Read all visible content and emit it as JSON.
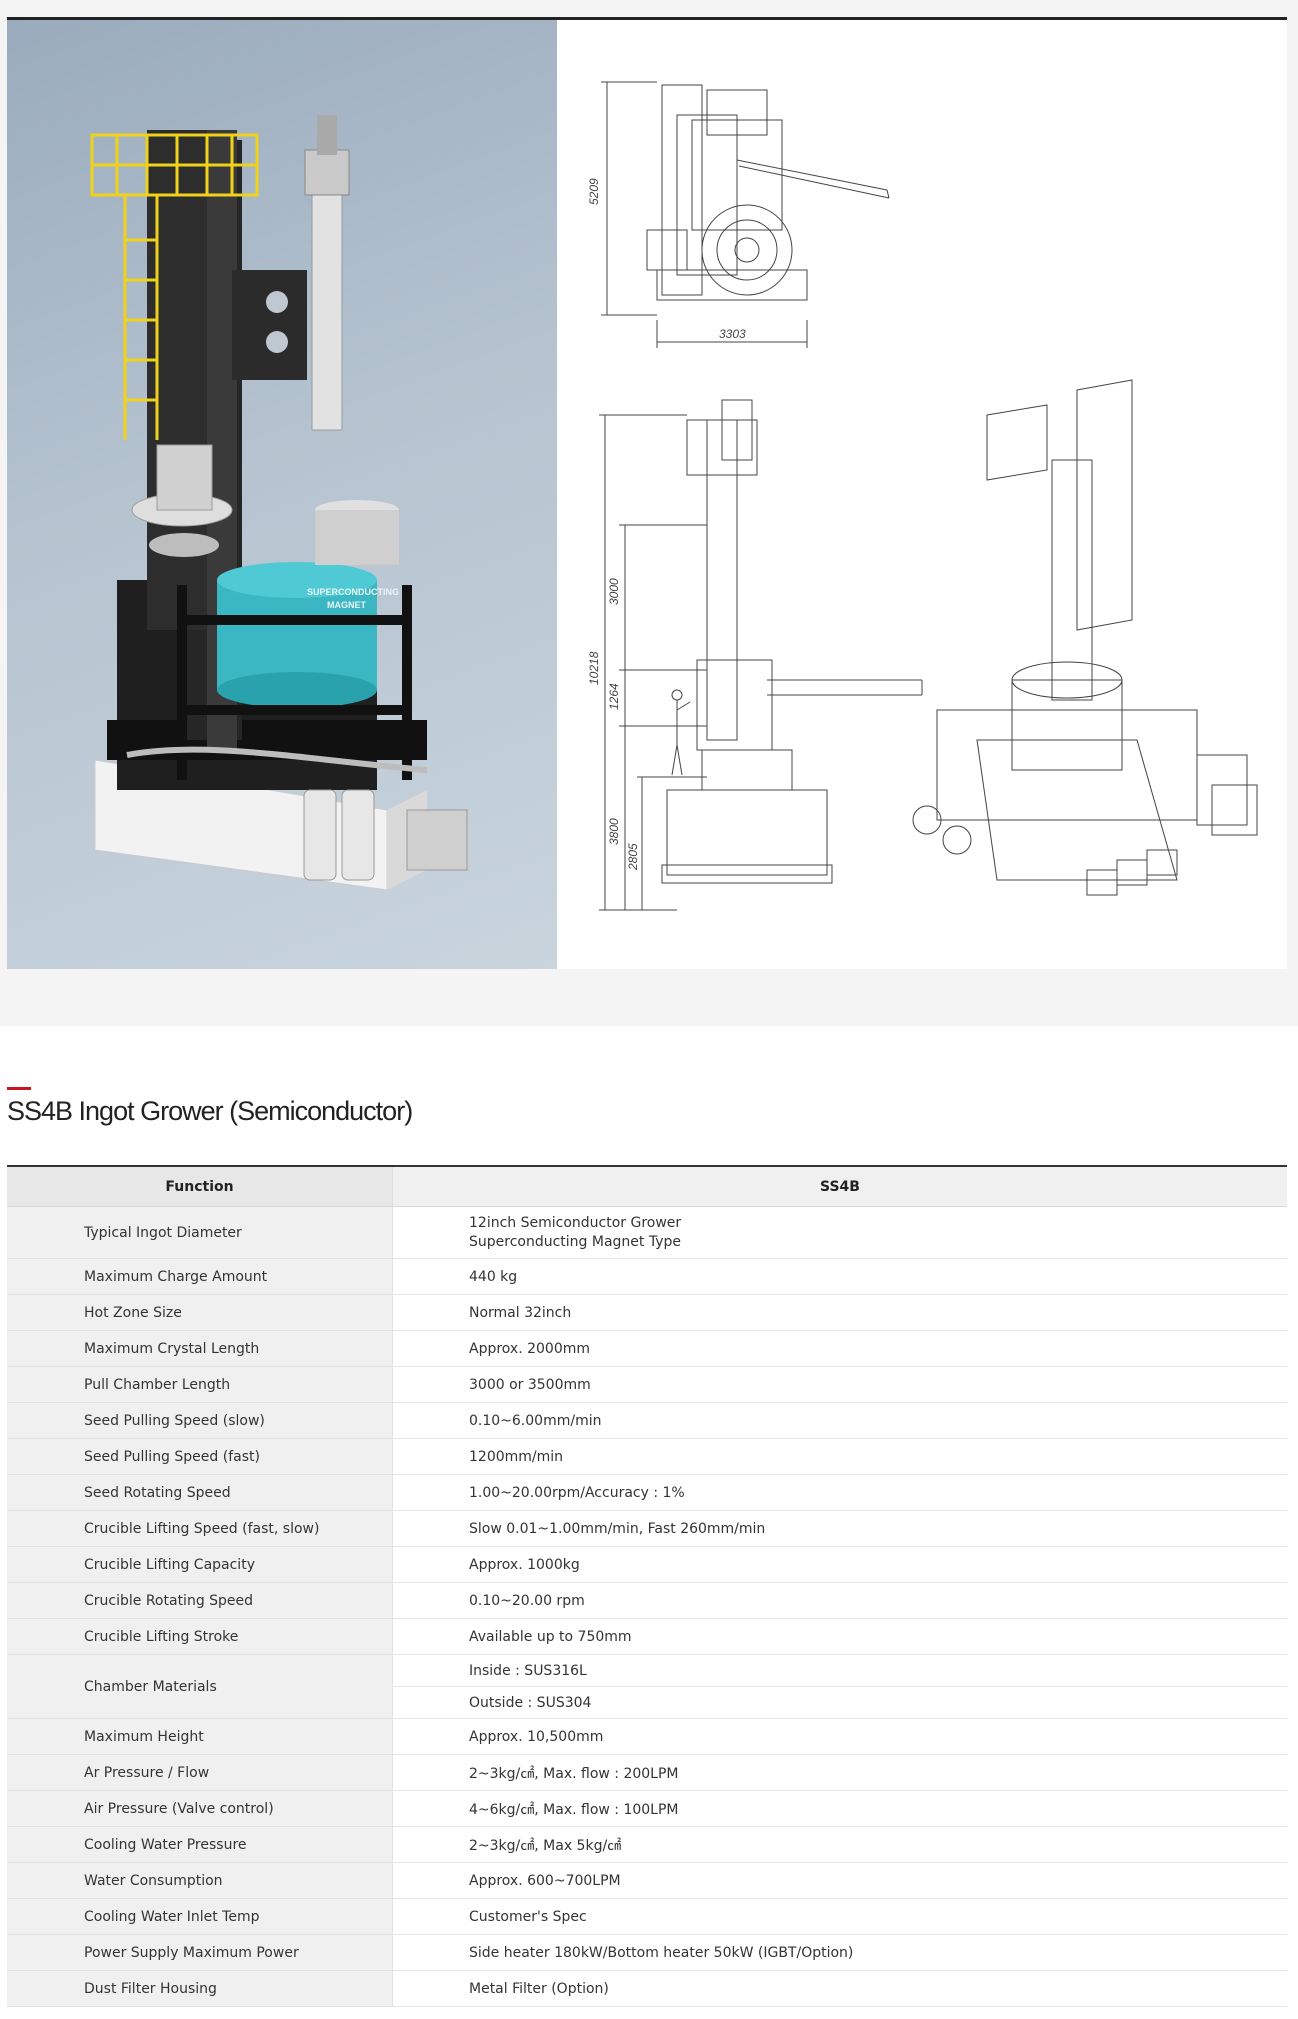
{
  "render": {
    "magnet_label_line1": "SUPERCONDUCTING",
    "magnet_label_line2": "MAGNET"
  },
  "drawing": {
    "top_view_dim_height": "5209",
    "top_view_dim_width": "3303",
    "side_view_dims": [
      "10218",
      "3000",
      "1264",
      "3800",
      "2805"
    ]
  },
  "section": {
    "title": "SS4B Ingot Grower (Semiconductor)"
  },
  "table": {
    "headers": [
      "Function",
      "SS4B"
    ],
    "rows": [
      {
        "label": "Typical Ingot Diameter",
        "values": [
          "12inch Semiconductor Grower",
          "Superconducting Magnet Type"
        ]
      },
      {
        "label": "Maximum Charge Amount",
        "values": [
          "440 kg"
        ]
      },
      {
        "label": "Hot Zone Size",
        "values": [
          "Normal 32inch"
        ]
      },
      {
        "label": "Maximum Crystal Length",
        "values": [
          "Approx. 2000mm"
        ]
      },
      {
        "label": "Pull Chamber Length",
        "values": [
          "3000 or 3500mm"
        ]
      },
      {
        "label": "Seed Pulling Speed (slow)",
        "values": [
          "0.10~6.00mm/min"
        ]
      },
      {
        "label": "Seed Pulling Speed (fast)",
        "values": [
          "1200mm/min"
        ]
      },
      {
        "label": "Seed Rotating Speed",
        "values": [
          "1.00~20.00rpm/Accuracy : 1%"
        ]
      },
      {
        "label": "Crucible Lifting Speed (fast, slow)",
        "values": [
          "Slow 0.01~1.00mm/min, Fast 260mm/min"
        ]
      },
      {
        "label": "Crucible Lifting Capacity",
        "values": [
          "Approx. 1000kg"
        ]
      },
      {
        "label": "Crucible Rotating Speed",
        "values": [
          "0.10~20.00 rpm"
        ]
      },
      {
        "label": "Crucible Lifting Stroke",
        "values": [
          "Available up to 750mm"
        ]
      },
      {
        "label": "Chamber Materials",
        "values": [
          "Inside : SUS316L",
          "Outside : SUS304"
        ]
      },
      {
        "label": "Maximum Height",
        "values": [
          "Approx. 10,500mm"
        ]
      },
      {
        "label": "Ar Pressure / Flow",
        "values": [
          "2~3kg/㎠, Max. flow : 200LPM"
        ]
      },
      {
        "label": "Air Pressure (Valve control)",
        "values": [
          "4~6kg/㎠, Max. flow : 100LPM"
        ]
      },
      {
        "label": "Cooling Water Pressure",
        "values": [
          "2~3kg/㎠, Max 5kg/㎠"
        ]
      },
      {
        "label": "Water Consumption",
        "values": [
          "Approx. 600~700LPM"
        ]
      },
      {
        "label": "Cooling Water Inlet Temp",
        "values": [
          "Customer's Spec"
        ]
      },
      {
        "label": "Power Supply Maximum Power",
        "values": [
          "Side heater 180kW/Bottom heater 50kW (IGBT/Option)"
        ]
      },
      {
        "label": "Dust Filter Housing",
        "values": [
          "Metal Filter (Option)"
        ]
      }
    ]
  }
}
